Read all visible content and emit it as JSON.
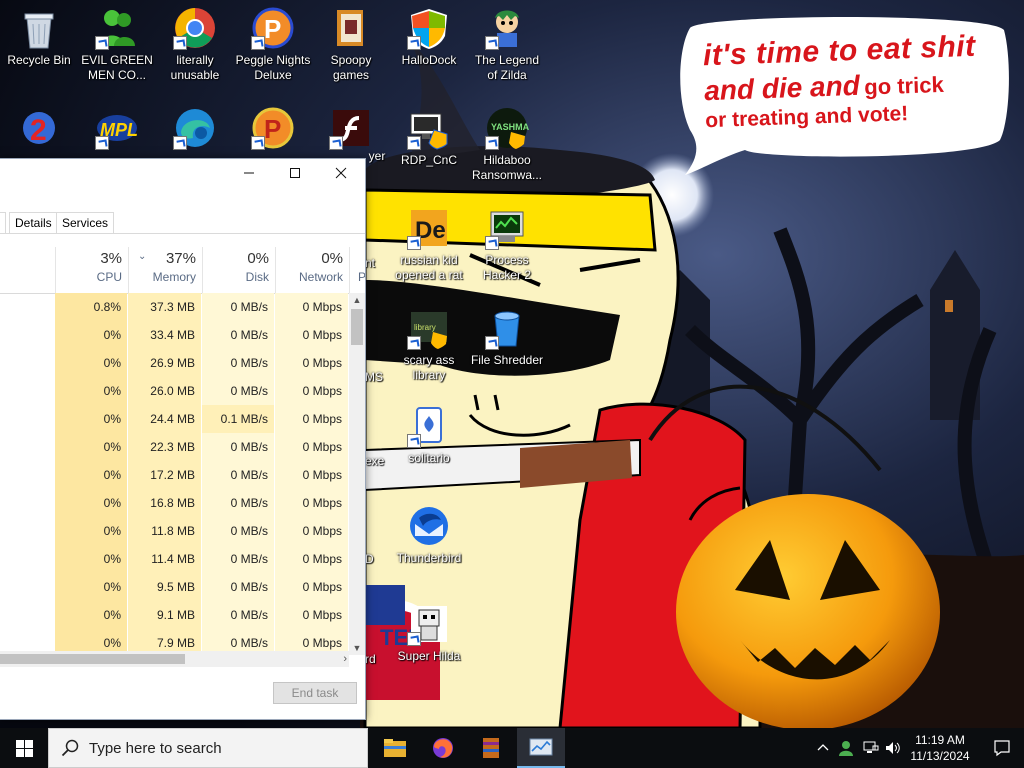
{
  "desktop": {
    "icons": [
      {
        "label": "Recycle Bin"
      },
      {
        "label": "EVIL GREEN MEN CO..."
      },
      {
        "label": "literally unusable"
      },
      {
        "label": "Peggle Nights Deluxe"
      },
      {
        "label": "Spoopy games"
      },
      {
        "label": "HalloDock"
      },
      {
        "label": "The Legend of Zilda"
      },
      {
        "label": "RDP_CnC"
      },
      {
        "label": "Hildaboo Ransomwa..."
      },
      {
        "label": "russian kid opened a rat"
      },
      {
        "label": "Process Hacker 2"
      },
      {
        "label": "scary ass library"
      },
      {
        "label": "File Shredder"
      },
      {
        "label": "solitario"
      },
      {
        "label": "Thunderbird"
      },
      {
        "label": "Super Hilda"
      }
    ],
    "partial_labels": [
      "yer",
      "nt",
      "MS",
      "exe",
      "D",
      "rd"
    ]
  },
  "wallpaper": {
    "speech_line1": "it's time to eat shit",
    "speech_line2a": "and die and",
    "speech_line2b": "go trick",
    "speech_line3": "or treating and vote!",
    "badge": "TED"
  },
  "task_manager": {
    "tabs": [
      "Details",
      "Services"
    ],
    "columns": [
      {
        "pct": "3%",
        "name": "CPU"
      },
      {
        "pct": "37%",
        "name": "Memory"
      },
      {
        "pct": "0%",
        "name": "Disk"
      },
      {
        "pct": "0%",
        "name": "Network"
      },
      {
        "pct": "",
        "name": "P"
      }
    ],
    "rows": [
      {
        "cpu": "0.8%",
        "memory": "37.3 MB",
        "disk": "0 MB/s",
        "network": "0 Mbps"
      },
      {
        "cpu": "0%",
        "memory": "33.4 MB",
        "disk": "0 MB/s",
        "network": "0 Mbps"
      },
      {
        "cpu": "0%",
        "memory": "26.9 MB",
        "disk": "0 MB/s",
        "network": "0 Mbps"
      },
      {
        "cpu": "0%",
        "memory": "26.0 MB",
        "disk": "0 MB/s",
        "network": "0 Mbps"
      },
      {
        "cpu": "0%",
        "memory": "24.4 MB",
        "disk": "0.1 MB/s",
        "network": "0 Mbps"
      },
      {
        "cpu": "0%",
        "memory": "22.3 MB",
        "disk": "0 MB/s",
        "network": "0 Mbps"
      },
      {
        "cpu": "0%",
        "memory": "17.2 MB",
        "disk": "0 MB/s",
        "network": "0 Mbps"
      },
      {
        "cpu": "0%",
        "memory": "16.8 MB",
        "disk": "0 MB/s",
        "network": "0 Mbps"
      },
      {
        "cpu": "0%",
        "memory": "11.8 MB",
        "disk": "0 MB/s",
        "network": "0 Mbps"
      },
      {
        "cpu": "0%",
        "memory": "11.4 MB",
        "disk": "0 MB/s",
        "network": "0 Mbps"
      },
      {
        "cpu": "0%",
        "memory": "9.5 MB",
        "disk": "0 MB/s",
        "network": "0 Mbps"
      },
      {
        "cpu": "0%",
        "memory": "9.1 MB",
        "disk": "0 MB/s",
        "network": "0 Mbps"
      },
      {
        "cpu": "0%",
        "memory": "7.9 MB",
        "disk": "0 MB/s",
        "network": "0 Mbps"
      }
    ],
    "end_task_label": "End task",
    "colors": {
      "heat_light": "#fff8d6",
      "heat_mid": "#fff0b8",
      "heat_strong": "#fde7a1"
    }
  },
  "taskbar": {
    "search_placeholder": "Type here to search",
    "apps": [
      "file-explorer-icon",
      "firefox-icon",
      "winrar-icon",
      "task-manager-icon"
    ],
    "time": "11:19 AM",
    "date": "11/13/2024"
  }
}
